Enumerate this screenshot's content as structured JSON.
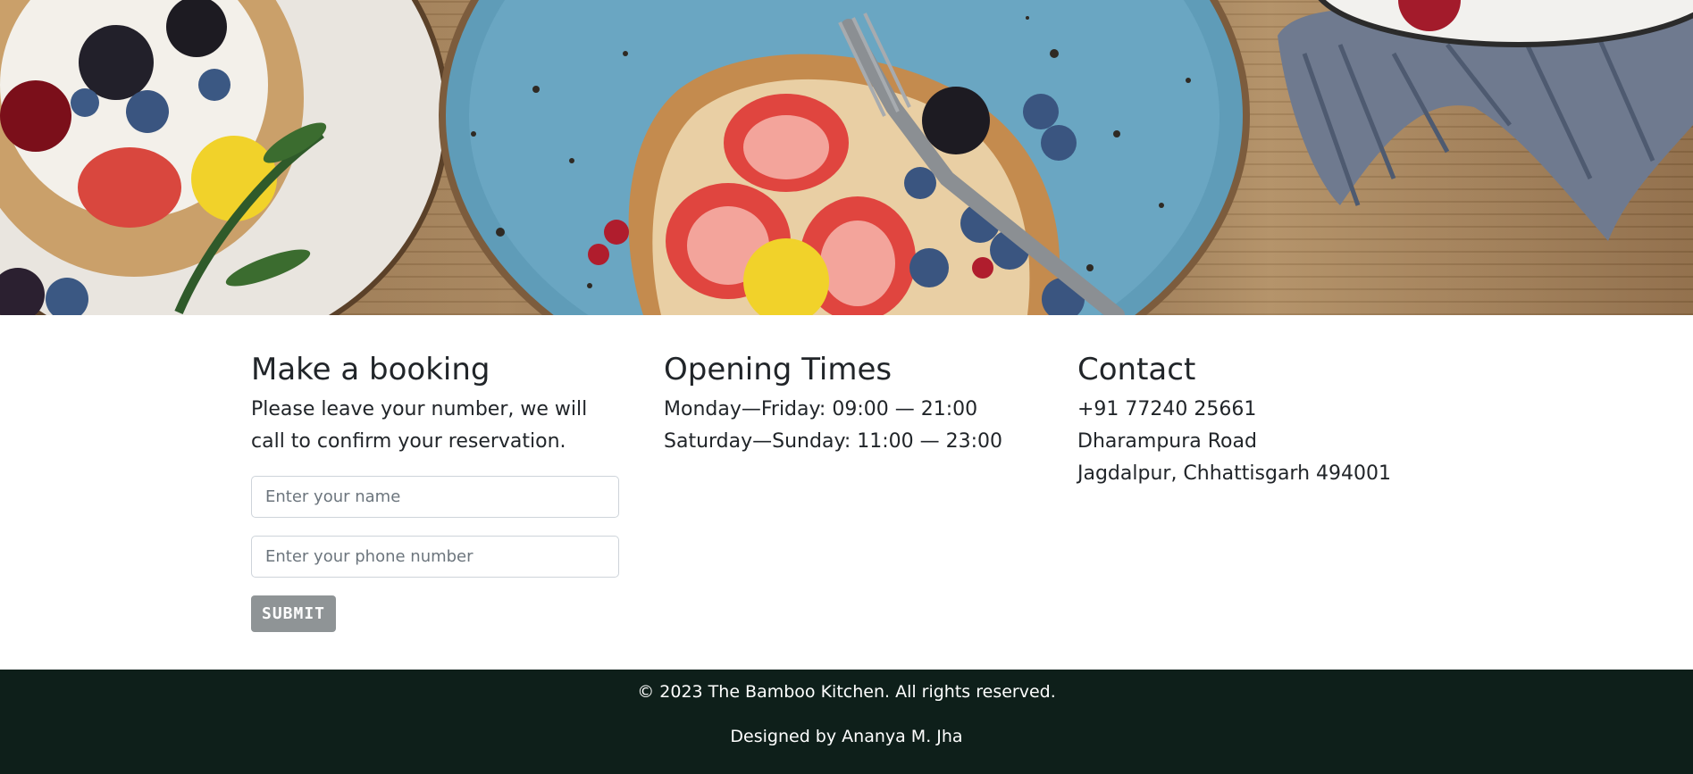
{
  "hero": {
    "image_description": ""
  },
  "booking": {
    "title": "Make a booking",
    "description": "Please leave your number, we will call to confirm your reservation.",
    "name_placeholder": "Enter your name",
    "phone_placeholder": "Enter your phone number",
    "submit_label": "SUBMIT"
  },
  "opening": {
    "title": "Opening Times",
    "lines": [
      "Monday—Friday: 09:00 — 21:00",
      "Saturday—Sunday: 11:00 — 23:00"
    ]
  },
  "contact": {
    "title": "Contact",
    "lines": [
      "+91 77240 25661",
      "Dharampura Road",
      "Jagdalpur, Chhattisgarh 494001"
    ]
  },
  "footer": {
    "copyright": "© 2023 The Bamboo Kitchen. All rights reserved.",
    "designer": "Designed by Ananya M. Jha"
  },
  "colors": {
    "footer_bg": "#0e1f1a",
    "button_bg": "#8f9496",
    "text": "#212529"
  }
}
